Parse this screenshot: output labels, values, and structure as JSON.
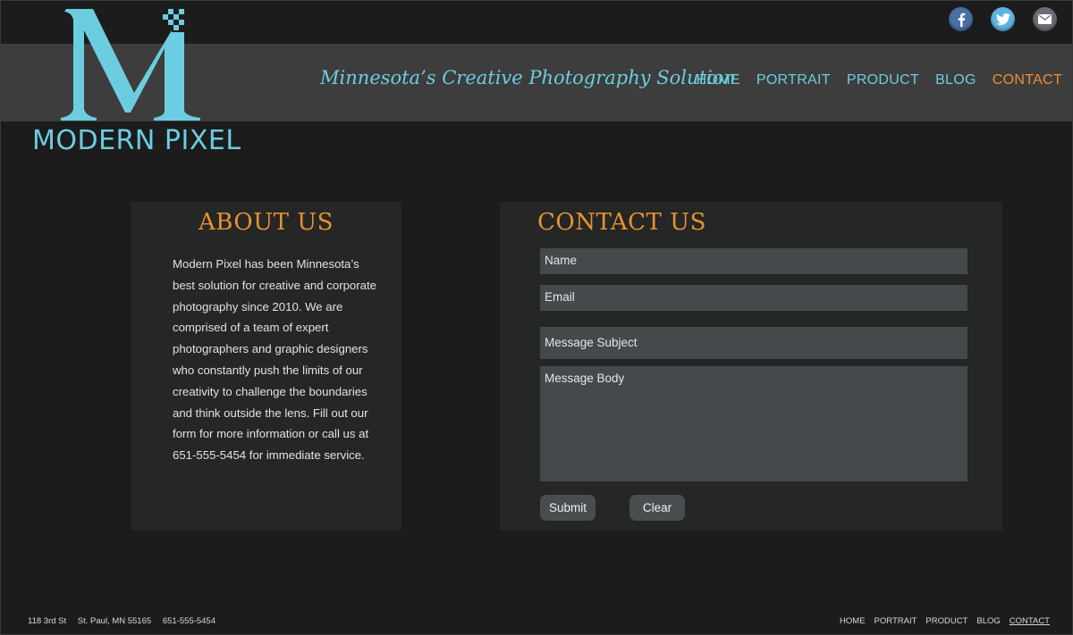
{
  "brand": {
    "name": "MODERN PIXEL",
    "tagline": "Minnesota’s Creative Photography Solution",
    "accent": "#6ccde0",
    "highlight": "#e8922f"
  },
  "social": [
    {
      "icon": "facebook-icon",
      "color": "#4a6fa5"
    },
    {
      "icon": "twitter-icon",
      "color": "#5fb3e3"
    },
    {
      "icon": "mail-icon",
      "color": "#6a6e74"
    }
  ],
  "nav": {
    "items": [
      "HOME",
      "PORTRAIT",
      "PRODUCT",
      "BLOG",
      "CONTACT"
    ],
    "active": "CONTACT"
  },
  "about": {
    "title": "ABOUT US",
    "body": "Modern Pixel has been Minnesota’s best solution for creative and corporate photography since 2010. We are comprised of a team of expert photographers and graphic designers who constantly push the limits of our creativity to challenge the boundaries and think outside the lens. Fill out our form for more information or call us at 651-555-5454 for immediate service."
  },
  "contact": {
    "title": "CONTACT US",
    "name_placeholder": "Name",
    "email_placeholder": "Email",
    "subject_placeholder": "Message Subject",
    "body_placeholder": "Message Body",
    "submit_label": "Submit",
    "clear_label": "Clear"
  },
  "footer": {
    "street": "118 3rd St",
    "city": "St. Paul, MN 55165",
    "phone": "651-555-5454",
    "nav": [
      "HOME",
      "PORTRAIT",
      "PRODUCT",
      "BLOG",
      "CONTACT"
    ]
  }
}
